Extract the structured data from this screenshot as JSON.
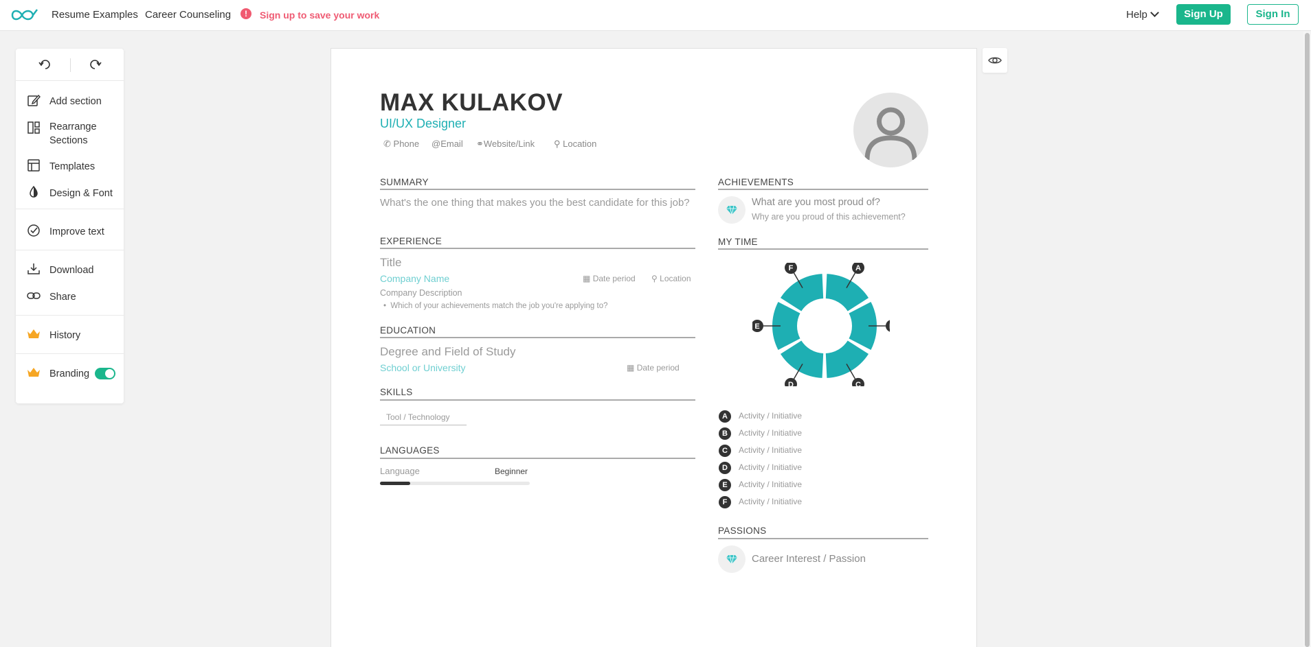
{
  "nav": {
    "resume_examples": "Resume Examples",
    "career_counseling": "Career Counseling",
    "warn_text": "Sign up to save your work",
    "help": "Help",
    "sign_up": "Sign Up",
    "sign_in": "Sign In"
  },
  "sidebar": {
    "items": [
      {
        "label": "Add section",
        "icon": "edit-icon"
      },
      {
        "label": "Rearrange\nSections",
        "icon": "layout-icon"
      },
      {
        "label": "Templates",
        "icon": "template-icon"
      },
      {
        "label": "Design & Font",
        "icon": "contrast-icon"
      },
      {
        "label": "Improve text",
        "icon": "check-circle-icon"
      },
      {
        "label": "Download",
        "icon": "download-icon"
      },
      {
        "label": "Share",
        "icon": "link-icon"
      },
      {
        "label": "History",
        "icon": "crown-icon"
      },
      {
        "label": "Branding",
        "icon": "crown-icon"
      }
    ],
    "branding_enabled": true
  },
  "resume": {
    "name": "MAX KULAKOV",
    "role": "UI/UX Designer",
    "contact": {
      "phone": "Phone",
      "email": "Email",
      "website": "Website/Link",
      "location": "Location"
    },
    "summary": {
      "title": "SUMMARY",
      "placeholder": "What's the one thing that makes you the best candidate for this job?"
    },
    "experience": {
      "title": "EXPERIENCE",
      "job_title": "Title",
      "company": "Company Name",
      "date": "Date period",
      "location": "Location",
      "description": "Company Description",
      "bullet": "Which of your achievements match the job you're applying to?"
    },
    "education": {
      "title": "EDUCATION",
      "degree": "Degree and Field of Study",
      "school": "School or University",
      "date": "Date period"
    },
    "skills": {
      "title": "SKILLS",
      "placeholder": "Tool / Technology"
    },
    "languages": {
      "title": "LANGUAGES",
      "language": "Language",
      "level": "Beginner",
      "level_fraction": 0.2
    },
    "achievements": {
      "title": "ACHIEVEMENTS",
      "heading": "What are you most proud of?",
      "sub": "Why are you proud of this achievement?"
    },
    "my_time": {
      "title": "MY TIME",
      "legend": [
        {
          "key": "A",
          "label": "Activity / Initiative"
        },
        {
          "key": "B",
          "label": "Activity / Initiative"
        },
        {
          "key": "C",
          "label": "Activity / Initiative"
        },
        {
          "key": "D",
          "label": "Activity / Initiative"
        },
        {
          "key": "E",
          "label": "Activity / Initiative"
        },
        {
          "key": "F",
          "label": "Activity / Initiative"
        }
      ]
    },
    "passions": {
      "title": "PASSIONS",
      "item": "Career Interest / Passion"
    }
  },
  "chart_data": {
    "type": "pie",
    "categories": [
      "A",
      "B",
      "C",
      "D",
      "E",
      "F"
    ],
    "values": [
      1,
      1,
      1,
      1,
      1,
      1
    ],
    "color": "#1eafb3"
  },
  "colors": {
    "accent": "#1ab68c",
    "teal": "#1eafb3",
    "warning": "#ef5b73"
  }
}
